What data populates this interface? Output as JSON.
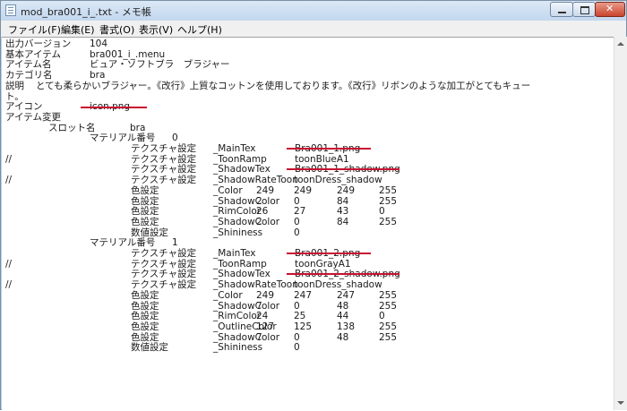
{
  "window": {
    "title": "mod_bra001_i_.txt - メモ帳",
    "controls": {
      "minimize": "minimize-icon",
      "maximize": "maximize-icon",
      "close": "close-icon"
    }
  },
  "menu": [
    {
      "label": "ファイル(F)"
    },
    {
      "label": "編集(E)"
    },
    {
      "label": "書式(O)"
    },
    {
      "label": "表示(V)"
    },
    {
      "label": "ヘルプ(H)"
    }
  ],
  "lines": [
    {
      "p": "",
      "i": "",
      "k": "出力バージョン",
      "v": "104",
      "a": "",
      "b": "",
      "c": "",
      "d": ""
    },
    {
      "p": "",
      "i": "",
      "k": "基本アイテム",
      "v": "bra001_i_.menu",
      "a": "",
      "b": "",
      "c": "",
      "d": ""
    },
    {
      "p": "",
      "i": "",
      "k": "アイテム名",
      "v": "ビュア・ソフトブラ　ブラジャー",
      "a": "",
      "b": "",
      "c": "",
      "d": ""
    },
    {
      "p": "",
      "i": "",
      "k": "カテゴリ名",
      "v": "bra",
      "a": "",
      "b": "",
      "c": "",
      "d": ""
    },
    {
      "p": "",
      "i": "",
      "k": "説明",
      "v": "とても柔らかいブラジャー。《改行》上質なコットンを使用しております。《改行》リボンのような加工がとてもキュー",
      "a": "",
      "b": "",
      "c": "",
      "d": ""
    },
    {
      "p": "",
      "i": "",
      "k": "ト。",
      "v": "",
      "a": "",
      "b": "",
      "c": "",
      "d": ""
    },
    {
      "p": "",
      "i": "",
      "k": "アイコン",
      "v": "icon.png",
      "a": "",
      "b": "",
      "c": "",
      "d": ""
    },
    {
      "p": "",
      "i": "",
      "k": "アイテム変更",
      "v": "",
      "a": "",
      "b": "",
      "c": "",
      "d": ""
    },
    {
      "p": "",
      "i": "",
      "k": "スロット名",
      "v": "bra",
      "a": "",
      "b": "",
      "c": "",
      "d": ""
    },
    {
      "p": "",
      "i": "",
      "k": "マテリアル番号",
      "v": "0",
      "a": "",
      "b": "",
      "c": "",
      "d": ""
    },
    {
      "p": "",
      "i": "",
      "k": "テクスチャ設定",
      "v": "_MainTex",
      "a": "Bra001_1.png",
      "b": "",
      "c": "",
      "d": ""
    },
    {
      "p": "//",
      "i": "",
      "k": "テクスチャ設定",
      "v": "_ToonRamp",
      "a": "toonBlueA1",
      "b": "",
      "c": "",
      "d": ""
    },
    {
      "p": "",
      "i": "",
      "k": "テクスチャ設定",
      "v": "_ShadowTex",
      "a": "Bra001_1_shadow.png",
      "b": "",
      "c": "",
      "d": ""
    },
    {
      "p": "//",
      "i": "",
      "k": "テクスチャ設定",
      "v": "_ShadowRateToon",
      "a": "toonDress_shadow",
      "b": "",
      "c": "",
      "d": ""
    },
    {
      "p": "",
      "i": "",
      "k": "色設定",
      "v": "_Color",
      "a": "249",
      "b": "249",
      "c": "249",
      "d": "255"
    },
    {
      "p": "",
      "i": "",
      "k": "色設定",
      "v": "_ShadowColor",
      "a": "2",
      "b": "0",
      "c": "84",
      "d": "255"
    },
    {
      "p": "",
      "i": "",
      "k": "色設定",
      "v": "_RimColor",
      "a": "26",
      "b": "27",
      "c": "43",
      "d": "0"
    },
    {
      "p": "",
      "i": "",
      "k": "色設定",
      "v": "_ShadowColor",
      "a": "2",
      "b": "0",
      "c": "84",
      "d": "255"
    },
    {
      "p": "",
      "i": "",
      "k": "数値設定",
      "v": "_Shininess",
      "a": "0",
      "b": "",
      "c": "",
      "d": ""
    },
    {
      "p": "",
      "i": "",
      "k": "マテリアル番号",
      "v": "1",
      "a": "",
      "b": "",
      "c": "",
      "d": ""
    },
    {
      "p": "",
      "i": "",
      "k": "テクスチャ設定",
      "v": "_MainTex",
      "a": "Bra001_2.png",
      "b": "",
      "c": "",
      "d": ""
    },
    {
      "p": "//",
      "i": "",
      "k": "テクスチャ設定",
      "v": "_ToonRamp",
      "a": "toonGrayA1",
      "b": "",
      "c": "",
      "d": ""
    },
    {
      "p": "",
      "i": "",
      "k": "テクスチャ設定",
      "v": "_ShadowTex",
      "a": "Bra001_2_shadow.png",
      "b": "",
      "c": "",
      "d": ""
    },
    {
      "p": "//",
      "i": "",
      "k": "テクスチャ設定",
      "v": "_ShadowRateToon",
      "a": "toonDress_shadow",
      "b": "",
      "c": "",
      "d": ""
    },
    {
      "p": "",
      "i": "",
      "k": "色設定",
      "v": "_Color",
      "a": "249",
      "b": "247",
      "c": "247",
      "d": "255"
    },
    {
      "p": "",
      "i": "",
      "k": "色設定",
      "v": "_ShadowColor",
      "a": "7",
      "b": "0",
      "c": "48",
      "d": "255"
    },
    {
      "p": "",
      "i": "",
      "k": "色設定",
      "v": "_RimColor",
      "a": "24",
      "b": "25",
      "c": "44",
      "d": "0"
    },
    {
      "p": "",
      "i": "",
      "k": "色設定",
      "v": "_OutlineColor",
      "a": "127",
      "b": "125",
      "c": "138",
      "d": "255"
    },
    {
      "p": "",
      "i": "",
      "k": "色設定",
      "v": "_ShadowColor",
      "a": "7",
      "b": "0",
      "c": "48",
      "d": "255"
    },
    {
      "p": "",
      "i": "",
      "k": "数値設定",
      "v": "_Shininess",
      "a": "0",
      "b": "",
      "c": "",
      "d": ""
    }
  ],
  "annotation_color": "#c8102e"
}
